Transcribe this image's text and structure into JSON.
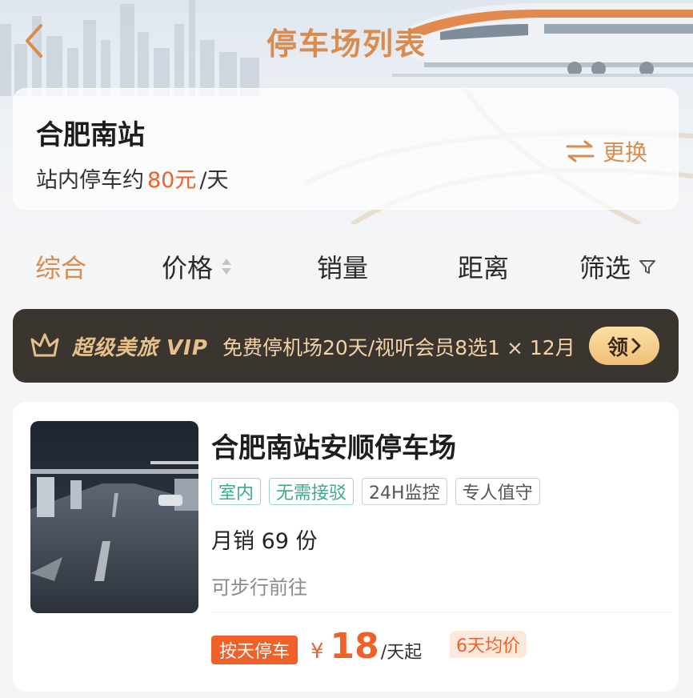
{
  "nav": {
    "title": "停车场列表",
    "back_icon": "chevron-left-icon"
  },
  "station": {
    "name": "合肥南站",
    "price_prefix": "站内停车约",
    "price_value": "80元",
    "price_unit": "/天",
    "switch_label": "更换",
    "switch_icon": "swap-arrows-icon"
  },
  "sort": {
    "tabs": [
      {
        "label": "综合",
        "active": true
      },
      {
        "label": "价格",
        "icon": "sort-updown-icon"
      },
      {
        "label": "销量"
      },
      {
        "label": "距离"
      },
      {
        "label": "筛选",
        "icon": "filter-funnel-icon"
      }
    ]
  },
  "vip": {
    "brand": "超级美旅 VIP",
    "offer": "免费停机场20天/视听会员8选1 × 12月",
    "claim_label": "领",
    "logo_icon": "vip-crown-icon"
  },
  "lot": {
    "name": "合肥南站安顺停车场",
    "tags": [
      "室内",
      "无需接驳",
      "24H监控",
      "专人值守"
    ],
    "sales": "月销 69 份",
    "walk": "可步行前往",
    "pill": "按天停车",
    "currency": "¥",
    "price": "18",
    "price_unit": "/天起",
    "avg_badge": "6天均价"
  },
  "colors": {
    "accent": "#d98c4e",
    "price": "#f0612a",
    "vip_bg": "#3b3530",
    "vip_text": "#f1d3a6",
    "tag_green": "#3ea98b"
  }
}
